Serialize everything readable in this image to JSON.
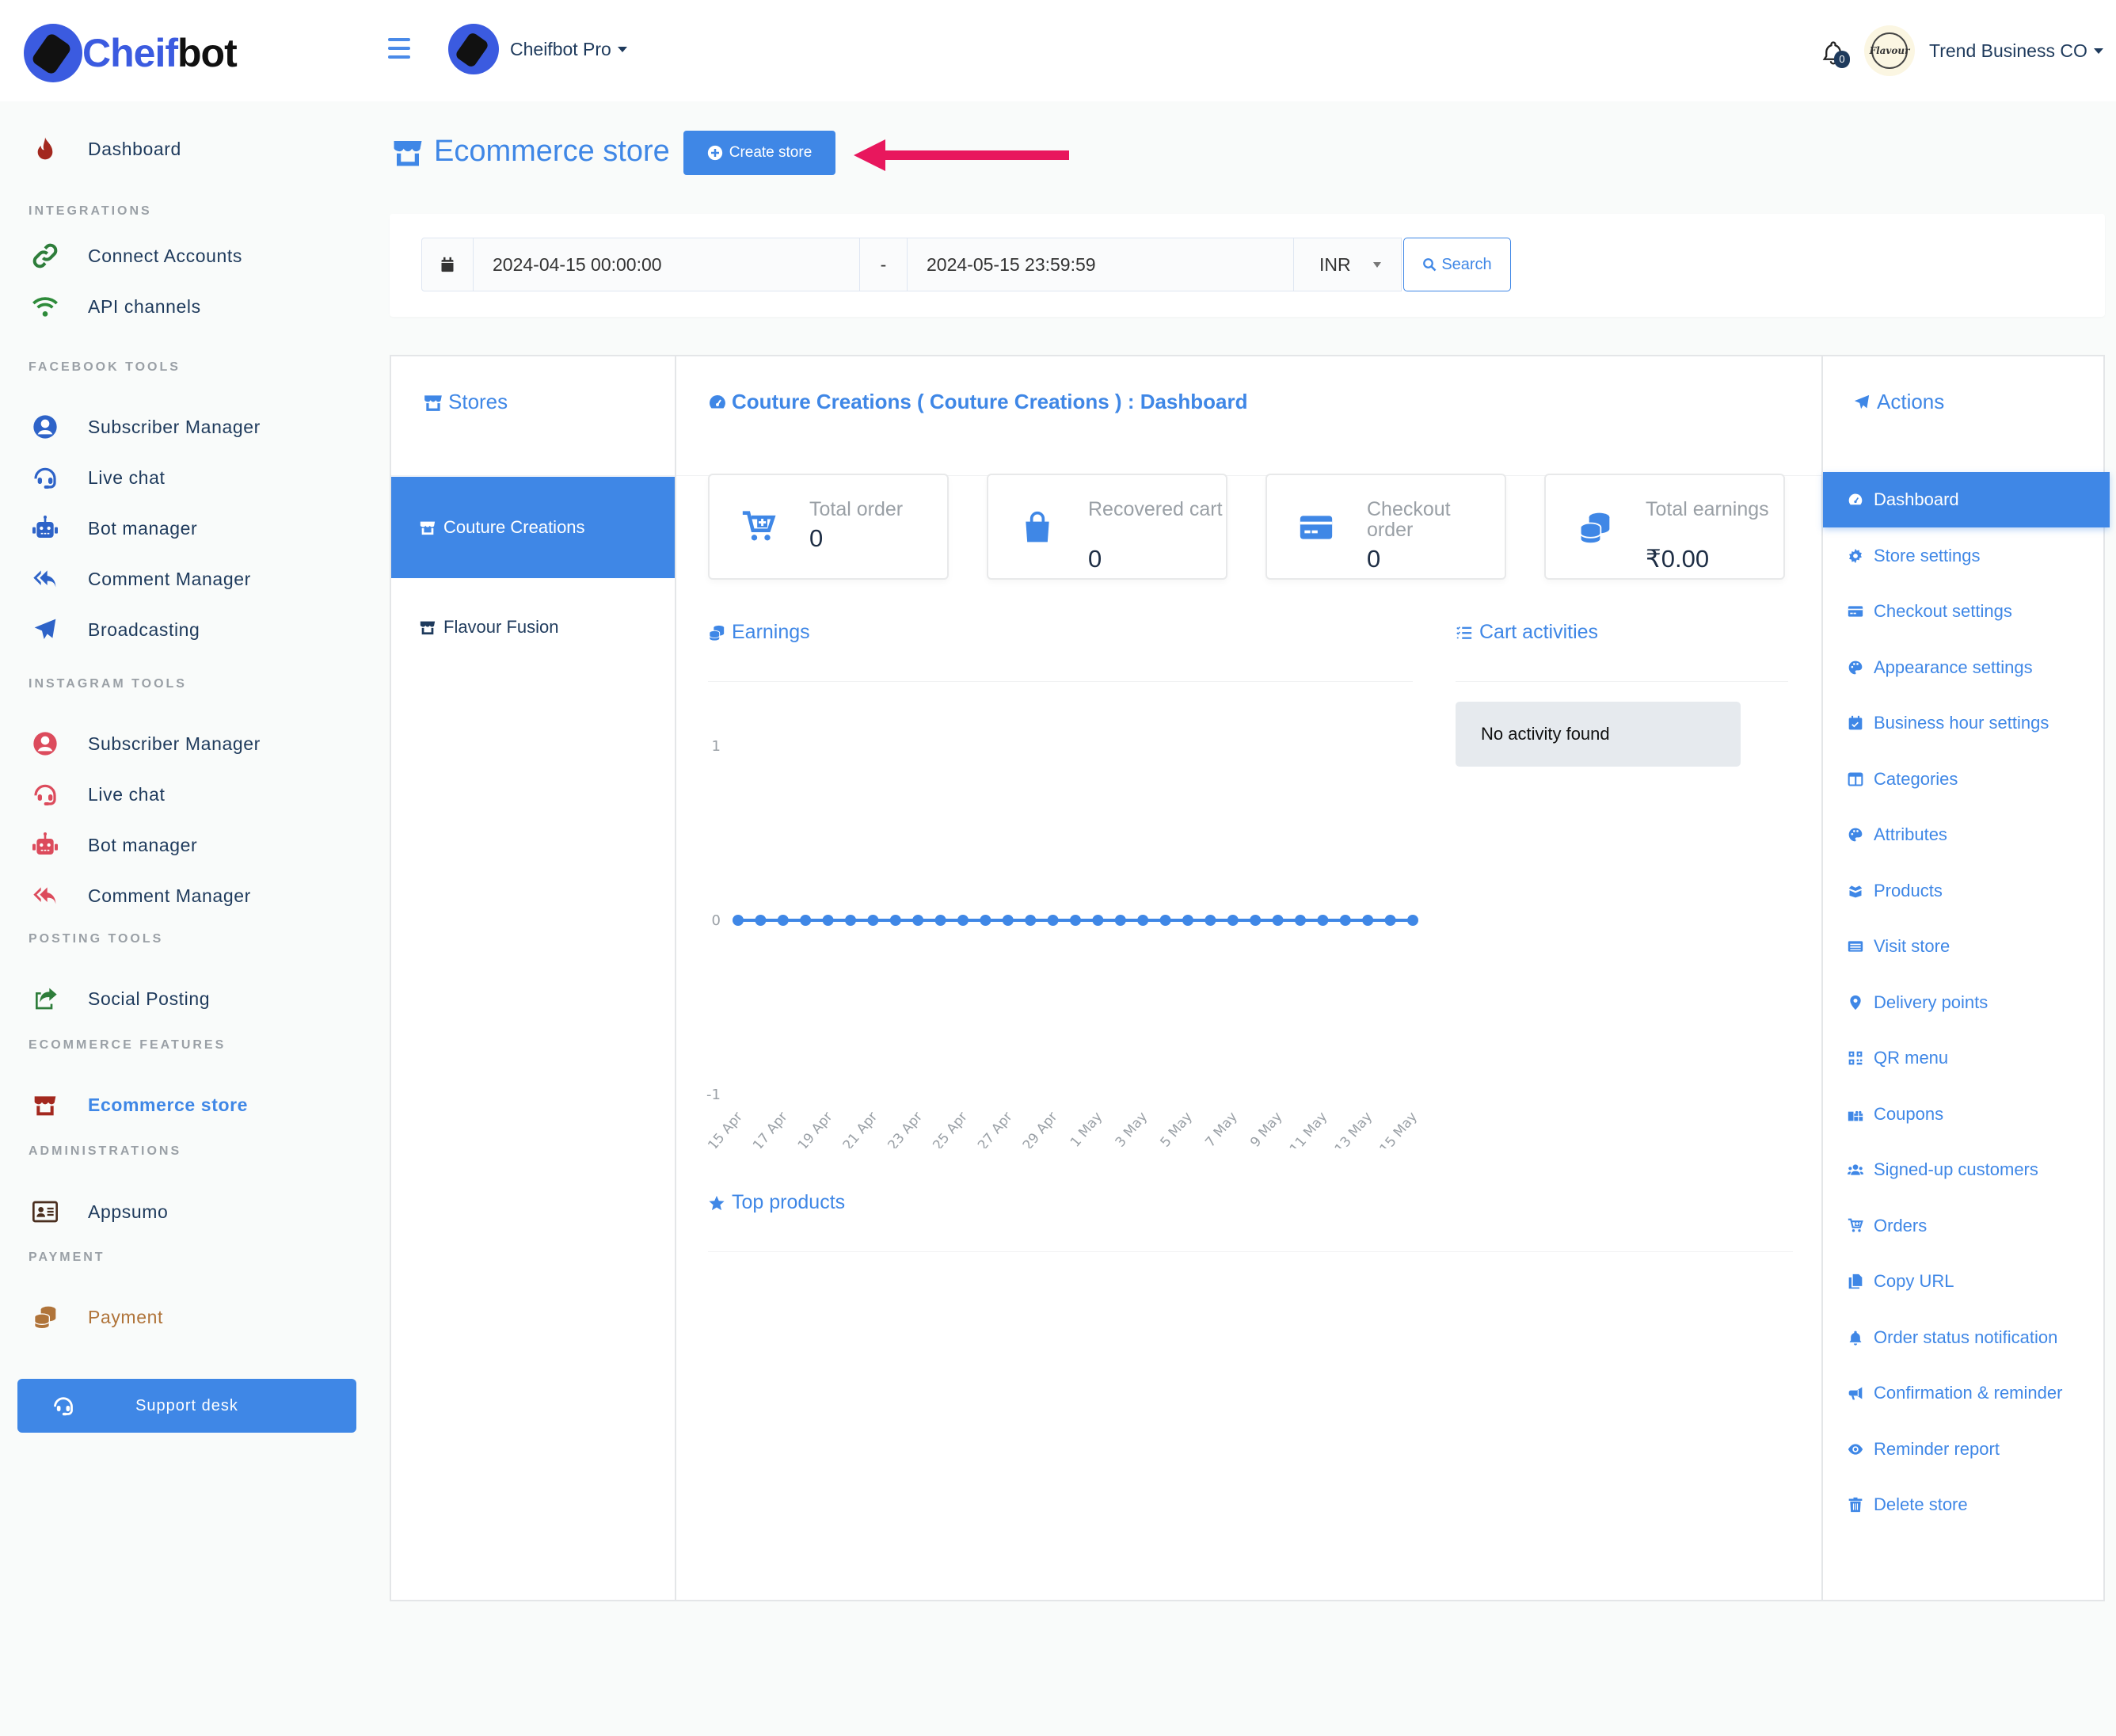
{
  "brand": {
    "name_part1": "Cheif",
    "name_part2": "bot"
  },
  "topbar": {
    "workspace_label": "Cheifbot Pro",
    "notification_count": "0",
    "account_name": "Trend Business CO",
    "avatar_text": "Flavour"
  },
  "sidebar": {
    "items": [
      {
        "type": "item",
        "label": "Dashboard",
        "icon": "fire-icon",
        "color": "#a3281e"
      },
      {
        "type": "section",
        "label": "INTEGRATIONS"
      },
      {
        "type": "item",
        "label": "Connect Accounts",
        "icon": "link-icon",
        "color": "#2e7d3a"
      },
      {
        "type": "item",
        "label": "API channels",
        "icon": "wifi-icon",
        "color": "#2e8b3a"
      },
      {
        "type": "section",
        "label": "FACEBOOK TOOLS"
      },
      {
        "type": "item",
        "label": "Subscriber Manager",
        "icon": "user-circle-icon",
        "color": "#2e63c8"
      },
      {
        "type": "item",
        "label": "Live chat",
        "icon": "headset-icon",
        "color": "#2e63c8"
      },
      {
        "type": "item",
        "label": "Bot manager",
        "icon": "robot-icon",
        "color": "#2e63c8"
      },
      {
        "type": "item",
        "label": "Comment Manager",
        "icon": "reply-all-icon",
        "color": "#2e63c8"
      },
      {
        "type": "item",
        "label": "Broadcasting",
        "icon": "paper-plane-icon",
        "color": "#2e63c8"
      },
      {
        "type": "section",
        "label": "INSTAGRAM TOOLS"
      },
      {
        "type": "item",
        "label": "Subscriber Manager",
        "icon": "user-circle-icon",
        "color": "#dc4b5c"
      },
      {
        "type": "item",
        "label": "Live chat",
        "icon": "headset-icon",
        "color": "#dc4b5c"
      },
      {
        "type": "item",
        "label": "Bot manager",
        "icon": "robot-icon",
        "color": "#dc4b5c"
      },
      {
        "type": "item",
        "label": "Comment Manager",
        "icon": "reply-all-icon",
        "color": "#dc4b5c"
      },
      {
        "type": "section",
        "label": "POSTING TOOLS"
      },
      {
        "type": "item",
        "label": "Social Posting",
        "icon": "share-square-icon",
        "color": "#2e7d3a"
      },
      {
        "type": "section",
        "label": "ECOMMERCE FEATURES"
      },
      {
        "type": "item",
        "label": "Ecommerce store",
        "icon": "store-icon",
        "color": "#a3281e",
        "active": true
      },
      {
        "type": "section",
        "label": "ADMINISTRATIONS"
      },
      {
        "type": "item",
        "label": "Appsumo",
        "icon": "id-card-icon",
        "color": "#4a2e1e"
      },
      {
        "type": "section",
        "label": "PAYMENT"
      },
      {
        "type": "item",
        "label": "Payment",
        "icon": "coins-icon",
        "color": "#b0743a",
        "text_color": "#b0743a"
      }
    ],
    "support_label": "Support desk"
  },
  "page": {
    "title": "Ecommerce store",
    "create_button": "Create store"
  },
  "filter": {
    "start_date": "2024-04-15 00:00:00",
    "separator": "-",
    "end_date": "2024-05-15 23:59:59",
    "currency": "INR",
    "search_label": "Search"
  },
  "stores": {
    "heading": "Stores",
    "items": [
      {
        "label": "Couture Creations",
        "active": true
      },
      {
        "label": "Flavour Fusion",
        "active": false
      }
    ]
  },
  "dashboard": {
    "heading": "Couture Creations ( Couture Creations ) : Dashboard",
    "stats": [
      {
        "label": "Total order",
        "value": "0",
        "icon": "cart-plus-icon"
      },
      {
        "label": "Recovered cart",
        "value": "0",
        "icon": "shopping-bag-icon"
      },
      {
        "label": "Checkout order",
        "value": "0",
        "icon": "credit-card-icon"
      },
      {
        "label": "Total earnings",
        "value": "₹0.00",
        "icon": "coins-icon"
      }
    ],
    "earnings_title": "Earnings",
    "cart_title": "Cart activities",
    "cart_empty": "No activity found",
    "top_products_title": "Top products"
  },
  "actions": {
    "heading": "Actions",
    "items": [
      {
        "label": "Dashboard",
        "icon": "tachometer-icon",
        "active": true
      },
      {
        "label": "Store settings",
        "icon": "gear-icon"
      },
      {
        "label": "Checkout settings",
        "icon": "credit-card-icon"
      },
      {
        "label": "Appearance settings",
        "icon": "palette-icon"
      },
      {
        "label": "Business hour settings",
        "icon": "calendar-check-icon"
      },
      {
        "label": "Categories",
        "icon": "columns-icon"
      },
      {
        "label": "Attributes",
        "icon": "palette-icon"
      },
      {
        "label": "Products",
        "icon": "box-open-icon"
      },
      {
        "label": "Visit store",
        "icon": "list-alt-icon"
      },
      {
        "label": "Delivery points",
        "icon": "map-marker-icon"
      },
      {
        "label": "QR menu",
        "icon": "qrcode-icon"
      },
      {
        "label": "Coupons",
        "icon": "gifts-icon"
      },
      {
        "label": "Signed-up customers",
        "icon": "users-icon"
      },
      {
        "label": "Orders",
        "icon": "cart-plus-icon"
      },
      {
        "label": "Copy URL",
        "icon": "copy-icon"
      },
      {
        "label": "Order status notification",
        "icon": "bell-icon"
      },
      {
        "label": "Confirmation & reminder",
        "icon": "bullhorn-icon"
      },
      {
        "label": "Reminder report",
        "icon": "eye-icon"
      },
      {
        "label": "Delete store",
        "icon": "trash-icon"
      }
    ]
  },
  "colors": {
    "accent": "#3f87e6",
    "annotation_arrow": "#e8175d"
  },
  "chart_data": {
    "type": "line",
    "title": "Earnings",
    "xlabel": "",
    "ylabel": "",
    "ylim": [
      -1,
      1
    ],
    "yticks": [
      "1",
      "0",
      "-1"
    ],
    "x": [
      "15 Apr",
      "16 Apr",
      "17 Apr",
      "18 Apr",
      "19 Apr",
      "20 Apr",
      "21 Apr",
      "22 Apr",
      "23 Apr",
      "24 Apr",
      "25 Apr",
      "26 Apr",
      "27 Apr",
      "28 Apr",
      "29 Apr",
      "30 Apr",
      "1 May",
      "2 May",
      "3 May",
      "4 May",
      "5 May",
      "6 May",
      "7 May",
      "8 May",
      "9 May",
      "10 May",
      "11 May",
      "12 May",
      "13 May",
      "14 May",
      "15 May"
    ],
    "xtick_labels": [
      "15 Apr",
      "17 Apr",
      "19 Apr",
      "21 Apr",
      "23 Apr",
      "25 Apr",
      "27 Apr",
      "29 Apr",
      "1 May",
      "3 May",
      "5 May",
      "7 May",
      "9 May",
      "11 May",
      "13 May",
      "15 May"
    ],
    "series": [
      {
        "name": "Earnings",
        "color": "#3f87e6",
        "values": [
          0,
          0,
          0,
          0,
          0,
          0,
          0,
          0,
          0,
          0,
          0,
          0,
          0,
          0,
          0,
          0,
          0,
          0,
          0,
          0,
          0,
          0,
          0,
          0,
          0,
          0,
          0,
          0,
          0,
          0,
          0
        ]
      }
    ],
    "grid": false,
    "legend": "none"
  }
}
